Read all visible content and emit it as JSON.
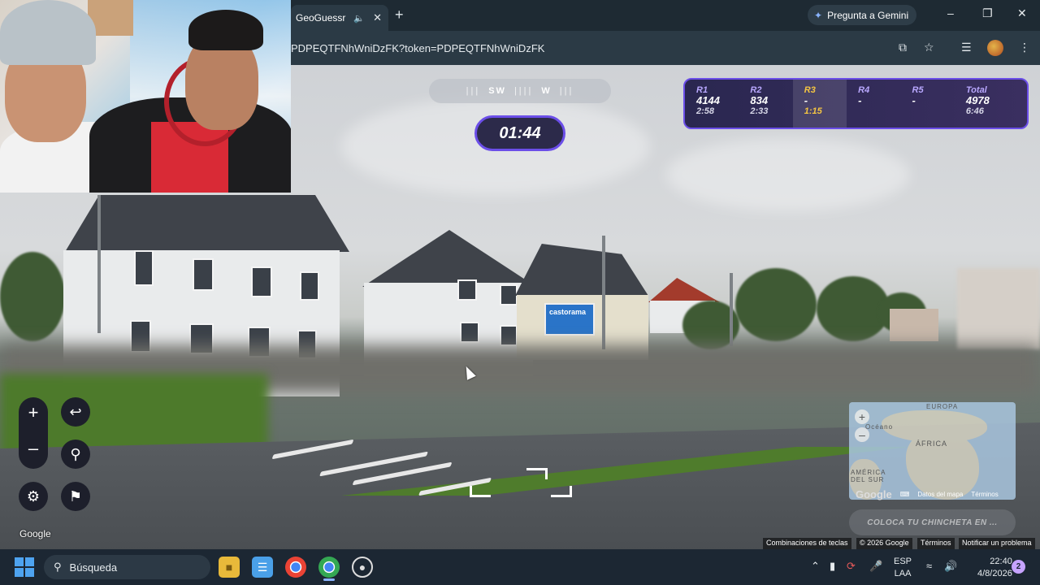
{
  "browser": {
    "tab_title": "GeoGuessr",
    "new_tab_symbol": "+",
    "gemini_label": "Pregunta a Gemini",
    "url": "PDPEQTFNhWniDzFK?token=PDPEQTFNhWniDzFK"
  },
  "game": {
    "compass": {
      "left": "SW",
      "right": "W"
    },
    "timer": "01:44",
    "rounds": [
      {
        "label": "R1",
        "score": "4144",
        "time": "2:58",
        "current": false
      },
      {
        "label": "R2",
        "score": "834",
        "time": "2:33",
        "current": false
      },
      {
        "label": "R3",
        "score": "-",
        "time": "1:15",
        "current": true
      },
      {
        "label": "R4",
        "score": "-",
        "time": "",
        "current": false
      },
      {
        "label": "R5",
        "score": "-",
        "time": "",
        "current": false
      }
    ],
    "total": {
      "label": "Total",
      "score": "4978",
      "time": "6:46"
    },
    "accent_color": "#6b4ee8",
    "current_round_color": "#f4c542",
    "guess_button": "COLOCA TU CHINCHETA EN ...",
    "google_watermark": "Google"
  },
  "map": {
    "labels": {
      "europa": "EUROPA",
      "africa": "ÁFRICA",
      "america": "AMÉRICA DEL SUR",
      "oceano": "Océano"
    },
    "footer_logo": "Google",
    "footer_data": "Datos del mapa",
    "footer_terms": "Términos"
  },
  "attribution": {
    "shortcuts": "Combinaciones de teclas",
    "copyright": "© 2026 Google",
    "terms": "Términos",
    "report": "Notificar un problema"
  },
  "scene": {
    "billboard": "castorama"
  },
  "taskbar": {
    "search_placeholder": "Búsqueda",
    "lang_top": "ESP",
    "lang_bottom": "LAA",
    "time": "22:40",
    "date": "4/8/2026",
    "notifications": "2"
  }
}
